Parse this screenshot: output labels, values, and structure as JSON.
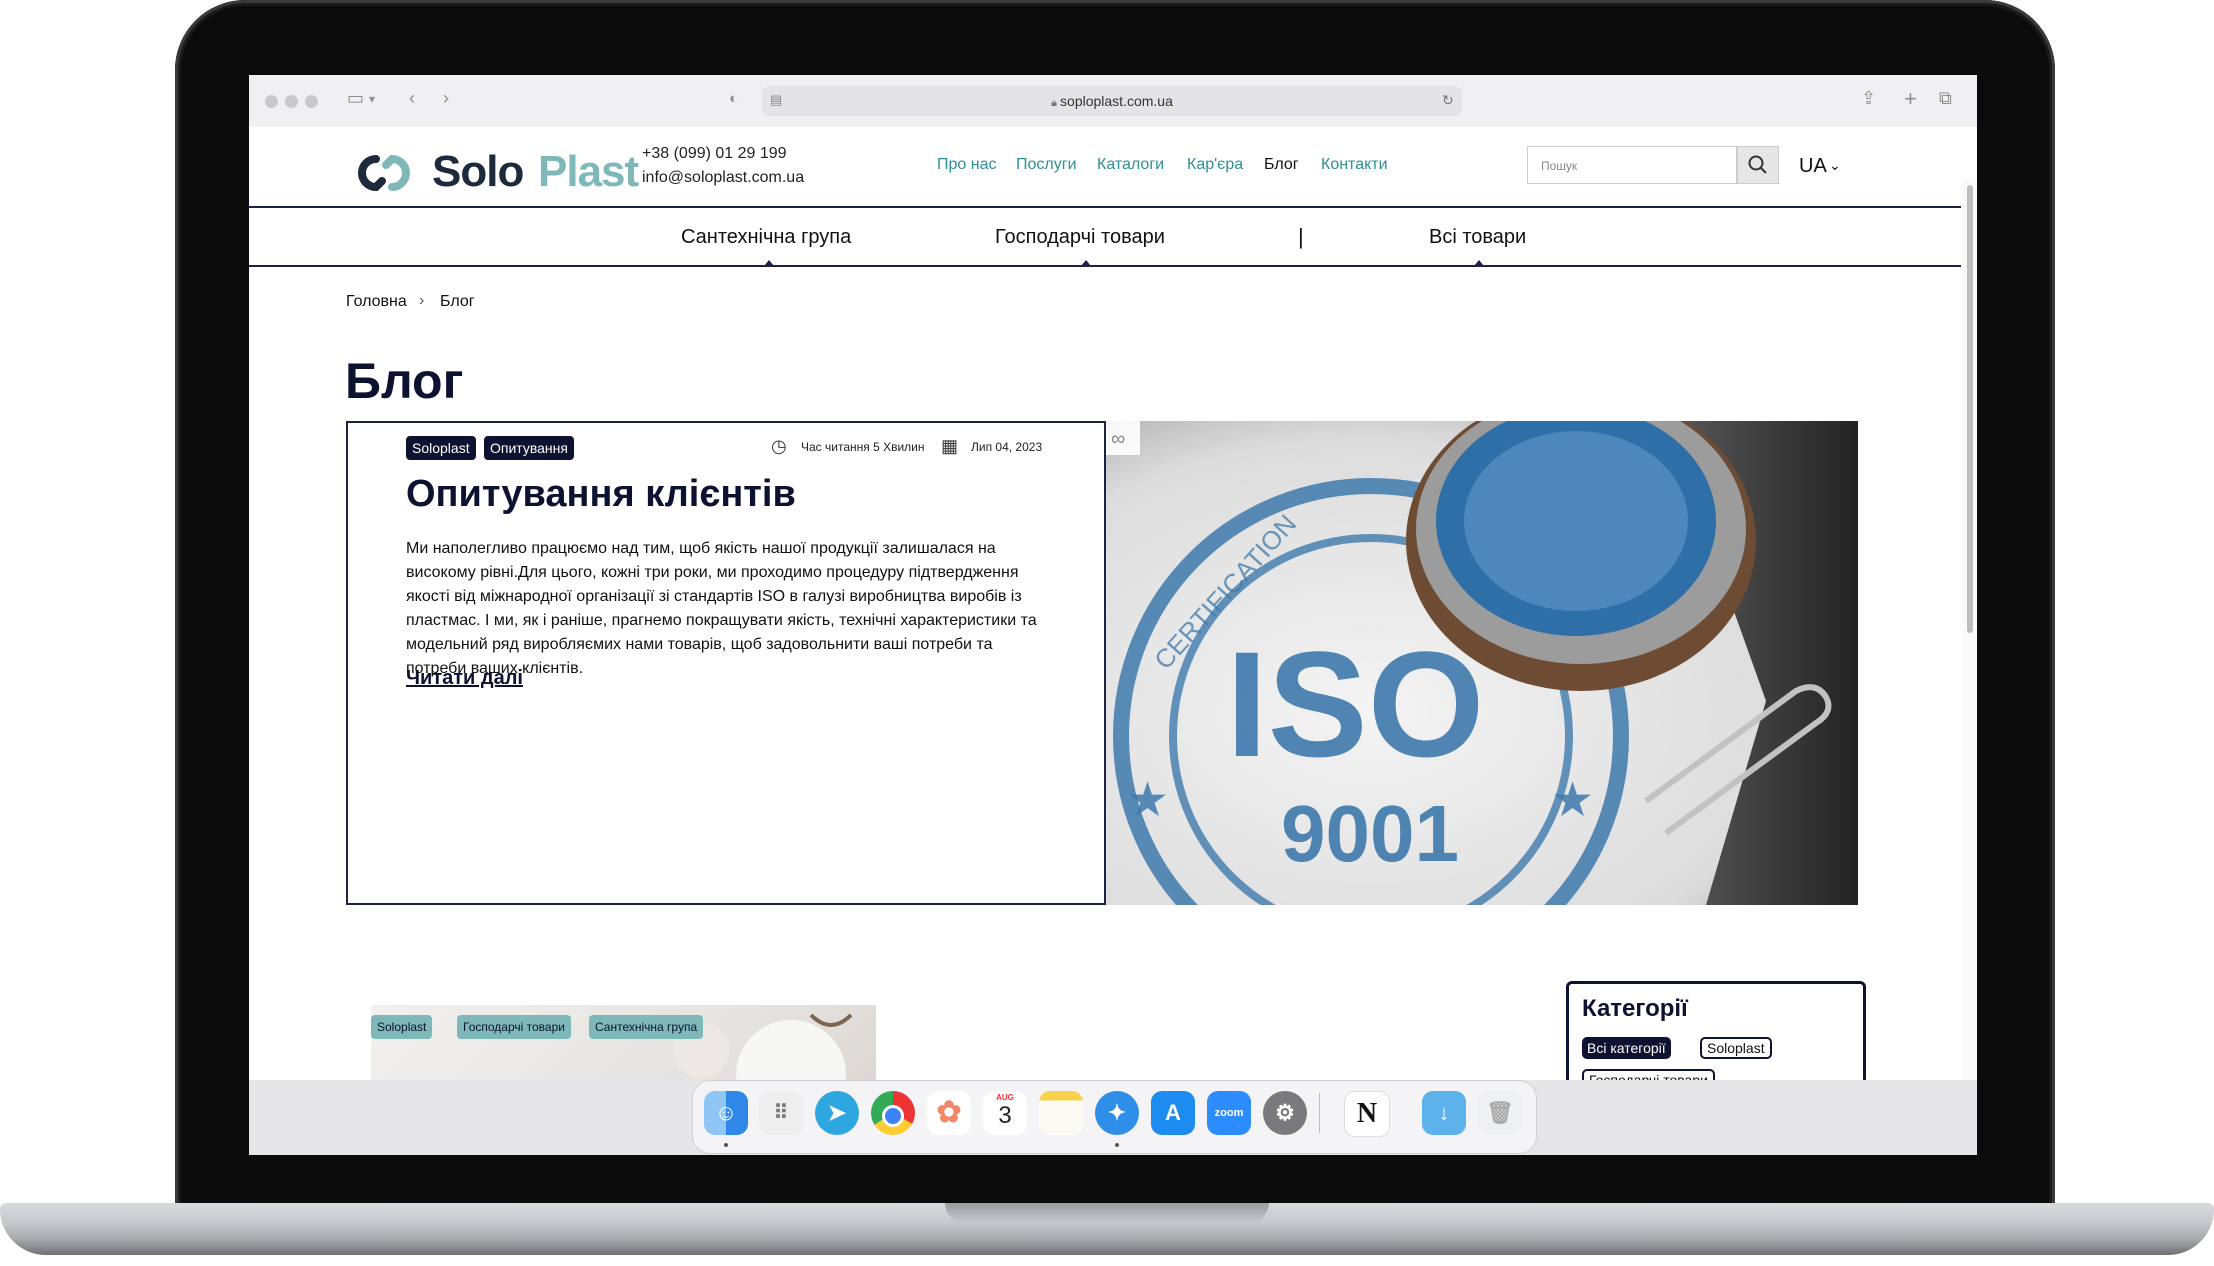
{
  "browser": {
    "url": "soploplast.com.ua"
  },
  "header": {
    "logo_solo": "Solo",
    "logo_plast": "Plast",
    "phone": "+38 (099) 01 29 199",
    "email": "info@soloplast.com.ua",
    "nav": [
      "Про нас",
      "Послуги",
      "Каталоги",
      "Кар'єра",
      "Блог",
      "Контакти"
    ],
    "active_nav": "Блог",
    "search_placeholder": "Пошук",
    "language": "UA"
  },
  "categories_bar": {
    "items": [
      "Сантехнічна група",
      "Господарчі товари",
      "Всі товари"
    ],
    "separator": "|"
  },
  "breadcrumb": {
    "home": "Головна",
    "separator": "›",
    "current": "Блог"
  },
  "page_title": "Блог",
  "featured_post": {
    "tags": [
      "Soloplast",
      "Опитування"
    ],
    "read_time": "Час читання 5 Хвилин",
    "date": "Лип 04, 2023",
    "title": "Опитування клієнтів",
    "text": "Ми наполегливо працюємо над тим, щоб якість нашої продукції залишалася на високому рівні.Для цього, кожні три роки, ми проходимо процедуру підтвердження якості від міжнародної організації зі стандартів ISO в галузі виробництва виробів із пластмас. І ми, як і раніше, прагнемо покращувати якість, технічні характеристики та модельний ряд виробляємих нами товарів, щоб задовольнити ваші потреби та потреби ваших клієнтів.",
    "read_more": "Читати далі",
    "image_text": {
      "iso": "ISO",
      "number": "9001",
      "ring": "CERTIFICATION"
    }
  },
  "second_post": {
    "tags": [
      "Soloplast",
      "Господарчі товари",
      "Сантехнічна група"
    ]
  },
  "sidebar_categories": {
    "title": "Категорії",
    "items": [
      "Всі категорії",
      "Soloplast",
      "Господарчі товари"
    ],
    "active": "Всі категорії"
  },
  "dock": {
    "calendar_month": "AUG",
    "calendar_day": "3",
    "zoom_label": "zoom"
  },
  "colors": {
    "brand_dark": "#0d1230",
    "brand_teal": "#7fb8b8",
    "nav_link": "#2e8f94"
  }
}
